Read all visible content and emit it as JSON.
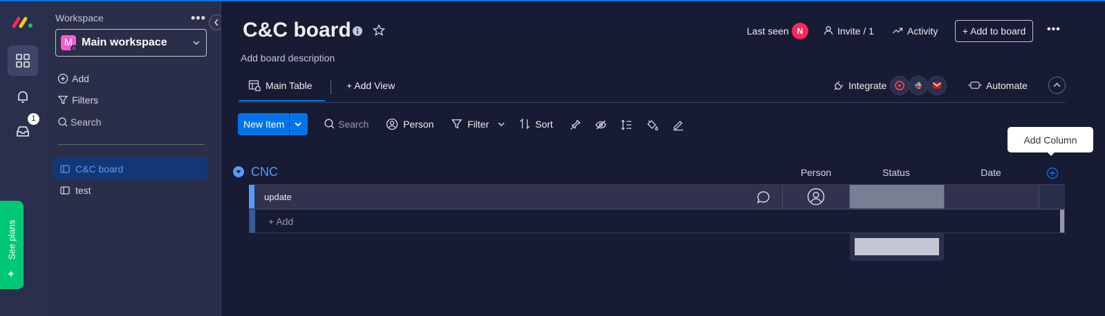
{
  "sidebar": {
    "workspace_label": "Workspace",
    "workspace_avatar": "M",
    "workspace_name": "Main workspace",
    "add_label": "Add",
    "filters_label": "Filters",
    "search_placeholder": "Search",
    "boards": [
      {
        "label": "C&C board",
        "active": true
      },
      {
        "label": "test",
        "active": false
      }
    ]
  },
  "rail": {
    "inbox_badge": "1",
    "see_plans_label": "See plans"
  },
  "header": {
    "title": "C&C board",
    "description": "Add board description",
    "last_seen_label": "Last seen",
    "last_seen_avatar": "N",
    "invite_label": "Invite / 1",
    "activity_label": "Activity",
    "add_to_board_label": "+ Add to board"
  },
  "views": {
    "main_table_label": "Main Table",
    "add_view_label": "+ Add View",
    "integrate_label": "Integrate",
    "automate_label": "Automate"
  },
  "toolbar": {
    "new_item_label": "New Item",
    "search_placeholder": "Search",
    "person_label": "Person",
    "filter_label": "Filter",
    "sort_label": "Sort"
  },
  "tooltip": {
    "add_column_label": "Add Column"
  },
  "group": {
    "name": "CNC",
    "columns": {
      "person": "Person",
      "status": "Status",
      "date": "Date"
    },
    "rows": [
      {
        "name": "update"
      }
    ],
    "add_item_label": "+ Add"
  },
  "colors": {
    "accent": "#0073ea",
    "group_blue": "#579bfc",
    "sidebar_active": "#133774",
    "see_plans_green": "#00c875",
    "last_seen_avatar": "#fb275d",
    "workspace_avatar": "#f65bd6"
  }
}
